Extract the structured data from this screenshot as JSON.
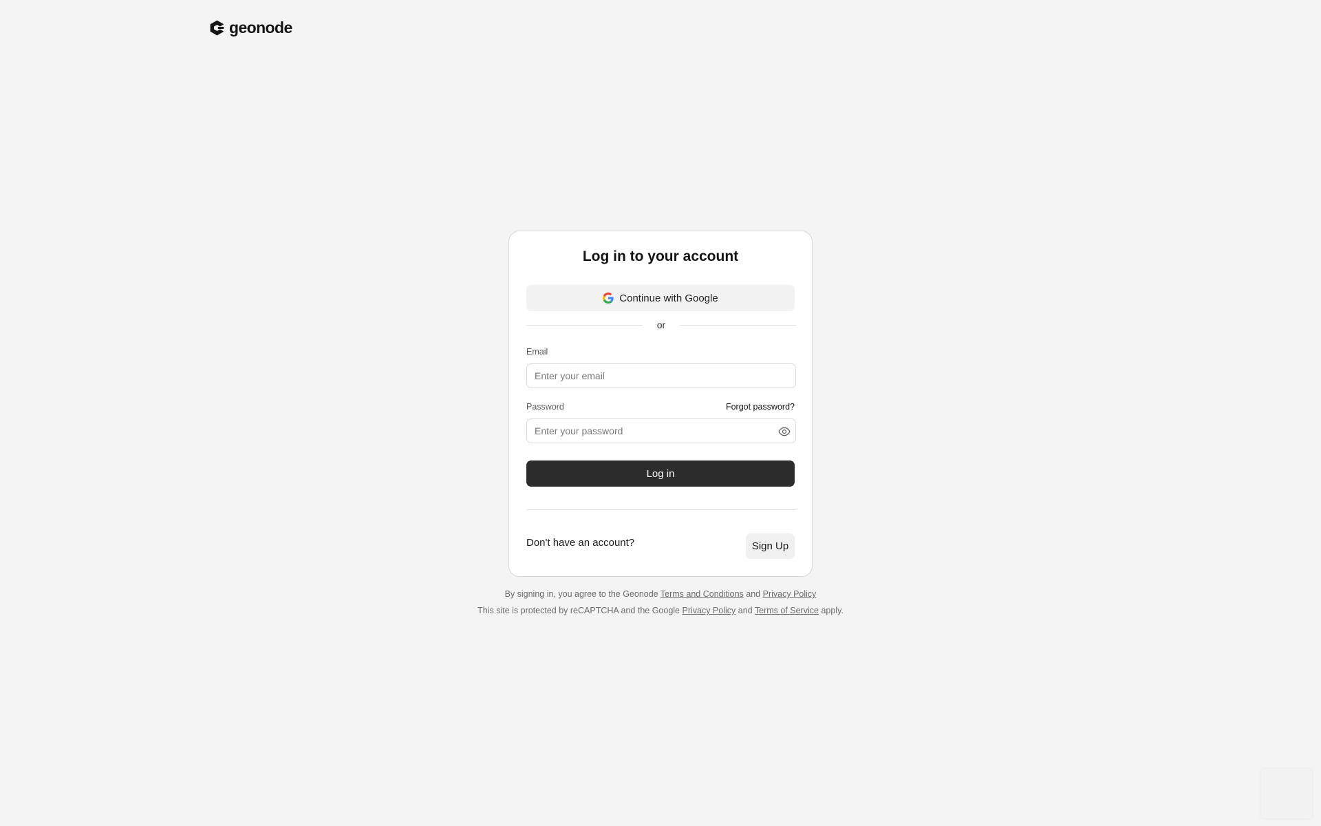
{
  "brand": {
    "name": "geonode"
  },
  "login_card": {
    "title": "Log in to your account",
    "google_button_label": "Continue with Google",
    "divider_text": "or",
    "email": {
      "label": "Email",
      "placeholder": "Enter your email",
      "value": ""
    },
    "password": {
      "label": "Password",
      "placeholder": "Enter your password",
      "value": ""
    },
    "forgot_password_label": "Forgot password?",
    "submit_label": "Log in",
    "no_account_text": "Don't have an account?",
    "signup_label": "Sign Up"
  },
  "legal": {
    "line1": {
      "prefix": "By signing in, you agree to the Geonode",
      "terms_link": "Terms and Conditions",
      "and": "and",
      "privacy_link": "Privacy Policy"
    },
    "line2": {
      "prefix": "This site is protected by reCAPTCHA and the Google",
      "privacy_link": "Privacy Policy",
      "and": "and",
      "tos_link": "Terms of Service",
      "suffix": "apply."
    }
  },
  "icons": {
    "logo": "geonode-logo-icon",
    "google": "google-icon",
    "eye": "eye-icon"
  },
  "colors": {
    "background": "#f4f4f4",
    "card": "#ffffff",
    "primary_button": "#2c2c2c",
    "secondary_button": "#f2f2f2"
  }
}
